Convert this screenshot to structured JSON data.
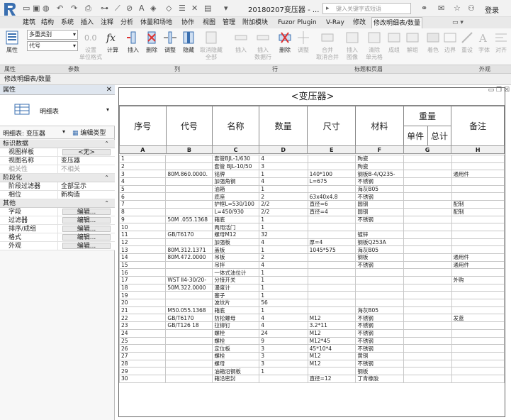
{
  "app": {
    "doc_title": "20180207变压器 - ...",
    "search_placeholder": "键入关键字或短语",
    "login_label": "登录"
  },
  "tabs": [
    "建筑",
    "结构",
    "系统",
    "插入",
    "注释",
    "分析",
    "体量和场地",
    "协作",
    "视图",
    "管理",
    "附加模块",
    "Fuzor Plugin",
    "V-Ray",
    "修改",
    "修改明细表/数量"
  ],
  "ribbon": {
    "properties": "属性",
    "params": [
      {
        "label": "多重类别"
      },
      {
        "label": "代号"
      }
    ],
    "params_buttons": [
      "设置\n单位格式",
      "计算"
    ],
    "col_buttons": [
      "插入",
      "删除",
      "调整",
      "隐藏",
      "取消隐藏\n全部"
    ],
    "row_buttons": [
      "插入",
      "插入\n数据行",
      "删除",
      "调整"
    ],
    "header_buttons": [
      "合并\n取消合并",
      "插入\n图像",
      "清除\n单元格",
      "成组",
      "解组"
    ],
    "look_buttons": [
      "着色",
      "边界",
      "重设",
      "字体",
      "对齐"
    ]
  },
  "ribbon_labels": [
    "属性",
    "参数",
    "列",
    "行",
    "标题和页眉",
    "外观"
  ],
  "context_bar": "修改明细表/数量",
  "panel": {
    "title": "属性",
    "type_name": "明细表",
    "instance_label": "明细表: 变压器",
    "edit_type": "编辑类型",
    "sections": [
      {
        "title": "标识数据",
        "rows": [
          {
            "k": "视图样板",
            "v": "<无>",
            "btn": true
          },
          {
            "k": "视图名称",
            "v": "变压器"
          },
          {
            "k": "相关性",
            "v": "不相关",
            "dim": true
          }
        ]
      },
      {
        "title": "阶段化",
        "rows": [
          {
            "k": "阶段过滤器",
            "v": "全部显示"
          },
          {
            "k": "相位",
            "v": "新构造"
          }
        ]
      },
      {
        "title": "其他",
        "rows": [
          {
            "k": "字段",
            "v": "编辑...",
            "btn": true
          },
          {
            "k": "过滤器",
            "v": "编辑...",
            "btn": true
          },
          {
            "k": "排序/成组",
            "v": "编辑...",
            "btn": true
          },
          {
            "k": "格式",
            "v": "编辑...",
            "btn": true
          },
          {
            "k": "外观",
            "v": "编辑...",
            "btn": true
          }
        ]
      }
    ]
  },
  "schedule": {
    "title": "<变压器>",
    "headers": {
      "seq": "序号",
      "code": "代号",
      "name": "名称",
      "qty": "数量",
      "size": "尺寸",
      "material": "材料",
      "weight": "重量",
      "unit": "单件",
      "total": "总计",
      "note": "备注"
    },
    "letters": [
      "A",
      "B",
      "C",
      "D",
      "E",
      "F",
      "G",
      "H"
    ],
    "rows": [
      [
        "1",
        "",
        "套管BJL-1/630",
        "4",
        "",
        "陶瓷",
        "",
        ""
      ],
      [
        "2",
        "",
        "套管 BJL-10/50",
        "3",
        "",
        "陶瓷",
        "",
        ""
      ],
      [
        "3",
        "80M.860.0000.",
        "铭牌",
        "1",
        "140*100",
        "钢板B-4/Q235-",
        "",
        "通用件"
      ],
      [
        "4",
        "",
        "加强角钢",
        "4",
        "L=675",
        "不锈钢",
        "",
        ""
      ],
      [
        "5",
        "",
        "油箱",
        "1",
        "",
        "海灰B05",
        "",
        ""
      ],
      [
        "6",
        "",
        "底座",
        "2",
        "63x40x4.8",
        "不锈钢",
        "",
        ""
      ],
      [
        "7",
        "",
        "护框L=530/100",
        "2/2",
        "直径=6",
        "圆钢",
        "",
        "配制"
      ],
      [
        "8",
        "",
        "L=450/930",
        "2/2",
        "直径=4",
        "圆钢",
        "",
        "配制"
      ],
      [
        "9",
        "50M .055.1368",
        "箱底",
        "1",
        "",
        "不锈钢",
        "",
        ""
      ],
      [
        "10",
        "",
        "两用活门",
        "1",
        "",
        "",
        "",
        ""
      ],
      [
        "11",
        "GB/T6170",
        "螺母M12",
        "32",
        "",
        "镀锌",
        "",
        ""
      ],
      [
        "12",
        "",
        "加强板",
        "4",
        "厚=4",
        "钢板Q253A",
        "",
        ""
      ],
      [
        "13",
        "80M.312.1371",
        "盖板",
        "1",
        "1045*575",
        "海灰B05",
        "",
        ""
      ],
      [
        "14",
        "80M.472.0000",
        "吊板",
        "2",
        "",
        "钢板",
        "",
        "通用件"
      ],
      [
        "15",
        "",
        "吊拌",
        "4",
        "",
        "不锈钢",
        "",
        "通用件"
      ],
      [
        "16",
        "",
        "一体式油位计",
        "1",
        "",
        "",
        "",
        ""
      ],
      [
        "17",
        "WST Ⅱ4-30/20-",
        "分接开关",
        "1",
        "",
        "",
        "",
        "外购"
      ],
      [
        "18",
        "50M.322.0000",
        "漫度计",
        "1",
        "",
        "",
        "",
        ""
      ],
      [
        "19",
        "",
        "塞子",
        "1",
        "",
        "",
        "",
        ""
      ],
      [
        "20",
        "",
        "波纹片",
        "56",
        "",
        "",
        "",
        ""
      ],
      [
        "21",
        "M50.055.1368",
        "箱底",
        "1",
        "",
        "海灰B05",
        "",
        ""
      ],
      [
        "22",
        "GB/T6170",
        "防松螺母",
        "4",
        "M12",
        "不锈钢",
        "",
        "发蓝"
      ],
      [
        "23",
        "GB/T126 18",
        "拉铆钉",
        "4",
        "3.2*11",
        "不锈钢",
        "",
        ""
      ],
      [
        "24",
        "",
        "螺栓",
        "24",
        "M12",
        "不锈钢",
        "",
        ""
      ],
      [
        "25",
        "",
        "螺栓",
        "9",
        "M12*45",
        "不锈钢",
        "",
        ""
      ],
      [
        "26",
        "",
        "定位板",
        "3",
        "45*10*4",
        "不锈钢",
        "",
        ""
      ],
      [
        "27",
        "",
        "螺栓",
        "3",
        "M12",
        "黄铜",
        "",
        ""
      ],
      [
        "28",
        "",
        "螺母",
        "3",
        "M12",
        "不锈钢",
        "",
        ""
      ],
      [
        "29",
        "",
        "油箱沿钢板",
        "1",
        "",
        "钢板",
        "",
        ""
      ],
      [
        "30",
        "",
        "箱沿密封",
        "",
        "直径=12",
        "丁青橡胶",
        "",
        ""
      ]
    ]
  }
}
